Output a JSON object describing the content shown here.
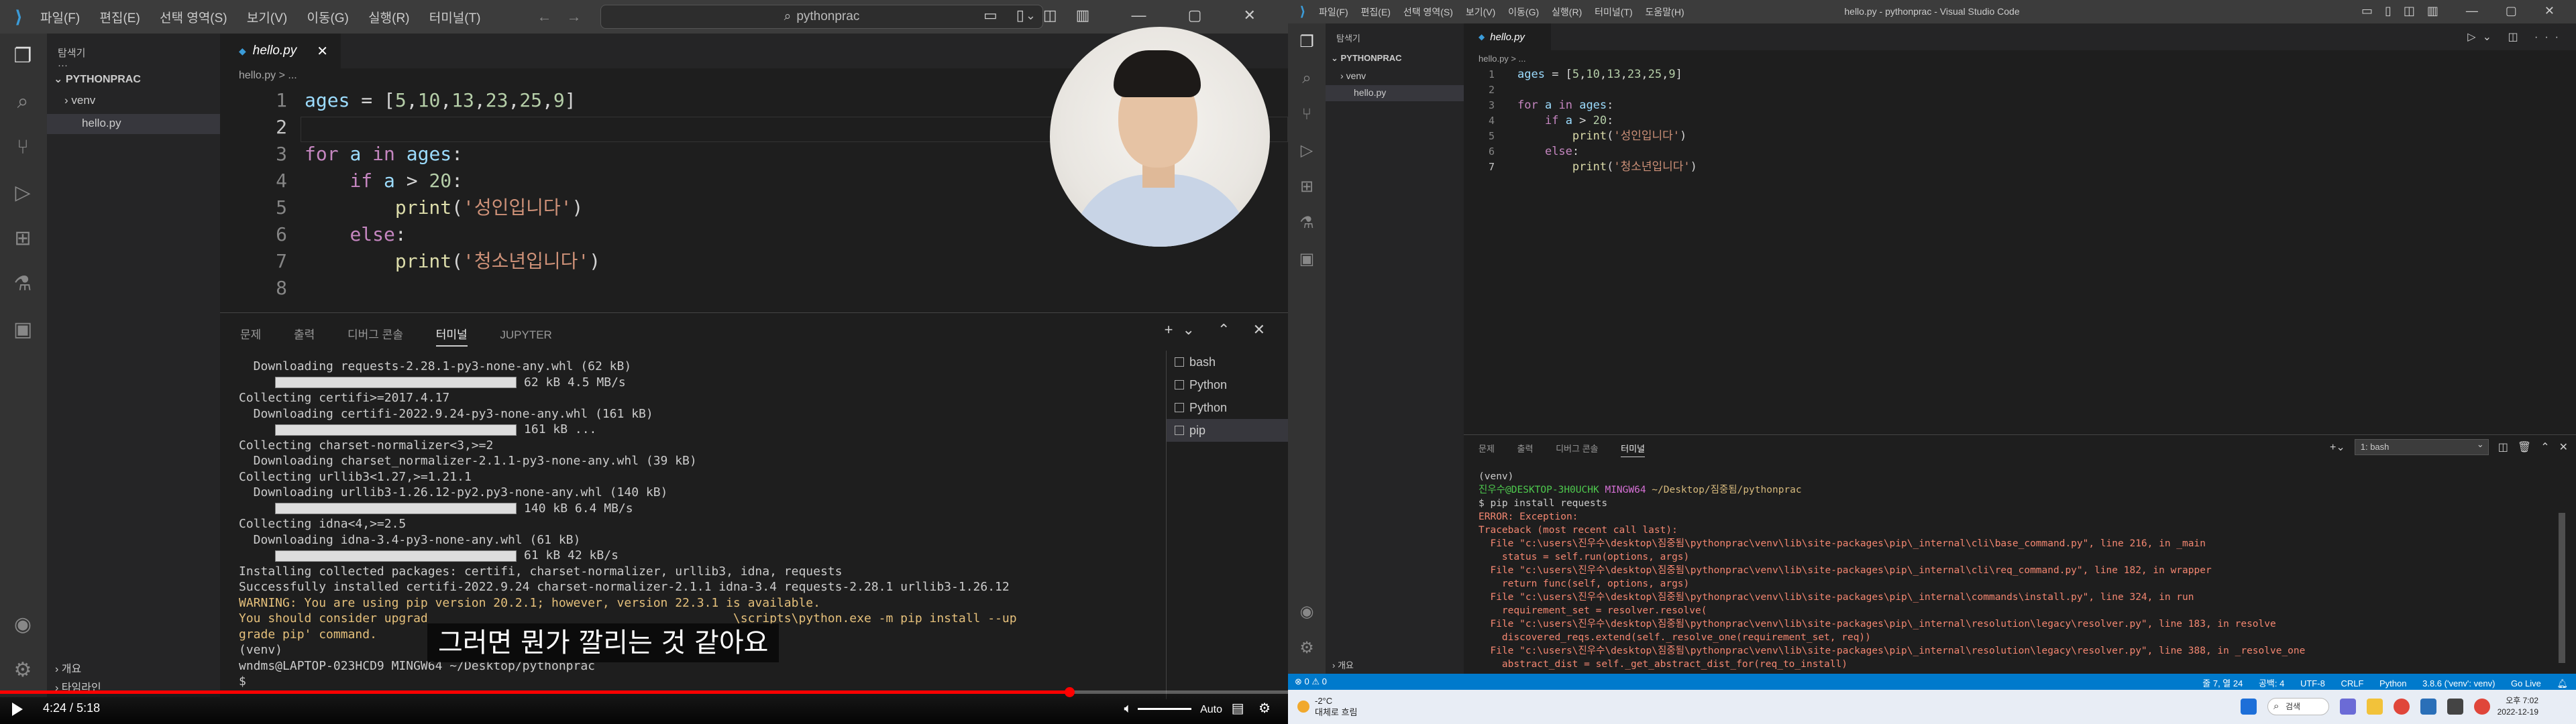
{
  "left": {
    "menu": [
      "파일(F)",
      "편집(E)",
      "선택 영역(S)",
      "보기(V)",
      "이동(G)",
      "실행(R)",
      "터미널(T)"
    ],
    "search_text": "pythonprac",
    "explorer": {
      "header": "탐색기",
      "project": "PYTHONPRAC",
      "items": [
        "venv",
        "hello.py"
      ],
      "bottom": [
        "개요",
        "타임라인"
      ]
    },
    "tab_label": "hello.py",
    "breadcrumb": "hello.py > ...",
    "code": [
      {
        "n": "1",
        "t": "ages = [5,10,13,23,25,9]"
      },
      {
        "n": "2",
        "t": ""
      },
      {
        "n": "3",
        "t": "for a in ages:"
      },
      {
        "n": "4",
        "t": "    if a > 20:"
      },
      {
        "n": "5",
        "t": "        print('성인입니다')"
      },
      {
        "n": "6",
        "t": "    else:"
      },
      {
        "n": "7",
        "t": "        print('청소년입니다')"
      },
      {
        "n": "8",
        "t": ""
      }
    ],
    "panel_tabs": [
      "문제",
      "출력",
      "디버그 콘솔",
      "터미널",
      "JUPYTER"
    ],
    "terminal_lines": [
      "  Downloading requests-2.28.1-py3-none-any.whl (62 kB)",
      "     [BAR] 62 kB 4.5 MB/s",
      "Collecting certifi>=2017.4.17",
      "  Downloading certifi-2022.9.24-py3-none-any.whl (161 kB)",
      "     [BAR] 161 kB ...",
      "Collecting charset-normalizer<3,>=2",
      "  Downloading charset_normalizer-2.1.1-py3-none-any.whl (39 kB)",
      "Collecting urllib3<1.27,>=1.21.1",
      "  Downloading urllib3-1.26.12-py2.py3-none-any.whl (140 kB)",
      "     [BAR] 140 kB 6.4 MB/s",
      "Collecting idna<4,>=2.5",
      "  Downloading idna-3.4-py3-none-any.whl (61 kB)",
      "     [BAR] 61 kB 42 kB/s",
      "Installing collected packages: certifi, charset-normalizer, urllib3, idna, requests",
      "Successfully installed certifi-2022.9.24 charset-normalizer-2.1.1 idna-3.4 requests-2.28.1 urllib3-1.26.12",
      "WARNING: You are using pip version 20.2.1; however, version 22.3.1 is available.",
      "You should consider upgrad                                          \\scripts\\python.exe -m pip install --up",
      "grade pip' command.",
      "(venv)",
      "wndms@LAPTOP-023HCD9 MINGW64 ~/Desktop/pythonprac",
      "$ "
    ],
    "terminal_list": [
      "bash",
      "Python",
      "Python",
      "pip"
    ],
    "subtitle": "그러면 뭔가 깔리는 것 같아요",
    "player": {
      "current_time": "4:24",
      "total_time": "5:18",
      "progress": 0.83,
      "auto_label": "Auto"
    }
  },
  "right": {
    "menu": [
      "파일(F)",
      "편집(E)",
      "선택 영역(S)",
      "보기(V)",
      "이동(G)",
      "실행(R)",
      "터미널(T)",
      "도움말(H)"
    ],
    "window_title": "hello.py - pythonprac - Visual Studio Code",
    "explorer": {
      "header": "탐색기",
      "project": "PYTHONPRAC",
      "items": [
        "venv",
        "hello.py"
      ],
      "bottom": [
        "개요"
      ]
    },
    "tab_label": "hello.py",
    "breadcrumb": "hello.py > ...",
    "code": [
      {
        "n": "1",
        "t": "ages = [5,10,13,23,25,9]"
      },
      {
        "n": "2",
        "t": ""
      },
      {
        "n": "3",
        "t": "for a in ages:"
      },
      {
        "n": "4",
        "t": "    if a > 20:"
      },
      {
        "n": "5",
        "t": "        print('성인입니다')"
      },
      {
        "n": "6",
        "t": "    else:"
      },
      {
        "n": "7",
        "t": "        print('청소년입니다')"
      }
    ],
    "panel_tabs": [
      "문제",
      "출력",
      "디버그 콘솔",
      "터미널"
    ],
    "terminal_select": "1: bash",
    "terminal_lines": [
      {
        "c": "",
        "t": "(venv)"
      },
      {
        "c": "prompt",
        "t": "진우수@DESKTOP-3H0UCHK MINGW64 ~/Desktop/짐중됨/pythonprac"
      },
      {
        "c": "",
        "t": "$ pip install requests"
      },
      {
        "c": "err",
        "t": "ERROR: Exception:"
      },
      {
        "c": "err",
        "t": "Traceback (most recent call last):"
      },
      {
        "c": "err",
        "t": "  File \"c:\\users\\진우수\\desktop\\짐중됨\\pythonprac\\venv\\lib\\site-packages\\pip\\_internal\\cli\\base_command.py\", line 216, in _main"
      },
      {
        "c": "err",
        "t": "    status = self.run(options, args)"
      },
      {
        "c": "err",
        "t": "  File \"c:\\users\\진우수\\desktop\\짐중됨\\pythonprac\\venv\\lib\\site-packages\\pip\\_internal\\cli\\req_command.py\", line 182, in wrapper"
      },
      {
        "c": "err",
        "t": "    return func(self, options, args)"
      },
      {
        "c": "err",
        "t": "  File \"c:\\users\\진우수\\desktop\\짐중됨\\pythonprac\\venv\\lib\\site-packages\\pip\\_internal\\commands\\install.py\", line 324, in run"
      },
      {
        "c": "err",
        "t": "    requirement_set = resolver.resolve("
      },
      {
        "c": "err",
        "t": "  File \"c:\\users\\진우수\\desktop\\짐중됨\\pythonprac\\venv\\lib\\site-packages\\pip\\_internal\\resolution\\legacy\\resolver.py\", line 183, in resolve"
      },
      {
        "c": "err",
        "t": "    discovered_reqs.extend(self._resolve_one(requirement_set, req))"
      },
      {
        "c": "err",
        "t": "  File \"c:\\users\\진우수\\desktop\\짐중됨\\pythonprac\\venv\\lib\\site-packages\\pip\\_internal\\resolution\\legacy\\resolver.py\", line 388, in _resolve_one"
      },
      {
        "c": "err",
        "t": "    abstract_dist = self._get_abstract_dist_for(req_to_install)"
      }
    ],
    "status_left": "⊗ 0 ⚠ 0",
    "status_right": [
      "줄 7, 열 24",
      "공백: 4",
      "UTF-8",
      "CRLF",
      "Python",
      "3.8.6 ('venv': venv)",
      "Go Live"
    ],
    "taskbar": {
      "weather_temp": "-2°C",
      "weather_desc": "대체로 흐림",
      "search_label": "검색",
      "clock_time": "오후 7:02",
      "clock_date": "2022-12-19"
    }
  }
}
